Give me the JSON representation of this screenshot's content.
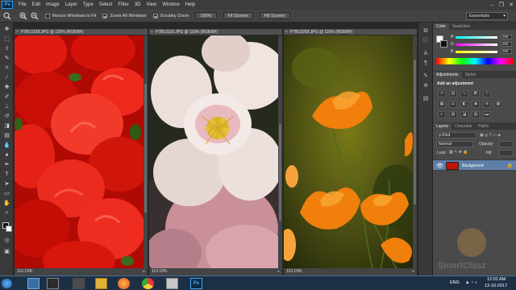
{
  "app": {
    "logo": "Ps"
  },
  "menu": {
    "items": [
      "File",
      "Edit",
      "Image",
      "Layer",
      "Type",
      "Select",
      "Filter",
      "3D",
      "View",
      "Window",
      "Help"
    ]
  },
  "window_controls": {
    "minimize": "–",
    "restore": "❐",
    "close": "✕"
  },
  "options_bar": {
    "resize_windows_label": "Resize Windows to Fit",
    "resize_windows_checked": false,
    "zoom_all_windows_label": "Zoom All Windows",
    "zoom_all_windows_checked": true,
    "scrubby_zoom_label": "Scrubby Zoom",
    "scrubby_zoom_checked": true,
    "btn_100": "100%",
    "btn_fit": "Fit Screen",
    "btn_fill": "Fill Screen",
    "workspace": "Essentials"
  },
  "documents": [
    {
      "tab": "P7BL0158.JPG @ 110% (RGB/8#)",
      "zoom": "110.19%"
    },
    {
      "tab": "P7BL0116.JPG @ 110% (RGB/8#)",
      "zoom": "110.19%"
    },
    {
      "tab": "P7BL0258.JPG @ 110% (RGB/8#)",
      "zoom": "110.19%"
    }
  ],
  "color_panel": {
    "tabs": [
      "Color",
      "Swatches"
    ],
    "channels": [
      {
        "label": "R",
        "value": "255"
      },
      {
        "label": "G",
        "value": "255"
      },
      {
        "label": "B",
        "value": "255"
      }
    ]
  },
  "adjustments_panel": {
    "tabs": [
      "Adjustments",
      "Styles"
    ],
    "heading": "Add an adjustment"
  },
  "layers_panel": {
    "tabs": [
      "Layers",
      "Channels",
      "Paths"
    ],
    "kind_label": "ρ Kind",
    "blend_mode": "Normal",
    "opacity_label": "Opacity:",
    "lock_label": "Lock:",
    "fill_label": "Fill:",
    "layer_name": "Background"
  },
  "taskbar": {
    "language": "ENG",
    "time": "12:02 AM",
    "date": "13-10-2017"
  },
  "watermark": {
    "text": "SmartClasz"
  },
  "colors": {
    "accent": "#3fa9f5",
    "selected_layer": "#5f7ea8",
    "panel_bg": "#4a4a4a",
    "chrome_dark": "#282828"
  }
}
